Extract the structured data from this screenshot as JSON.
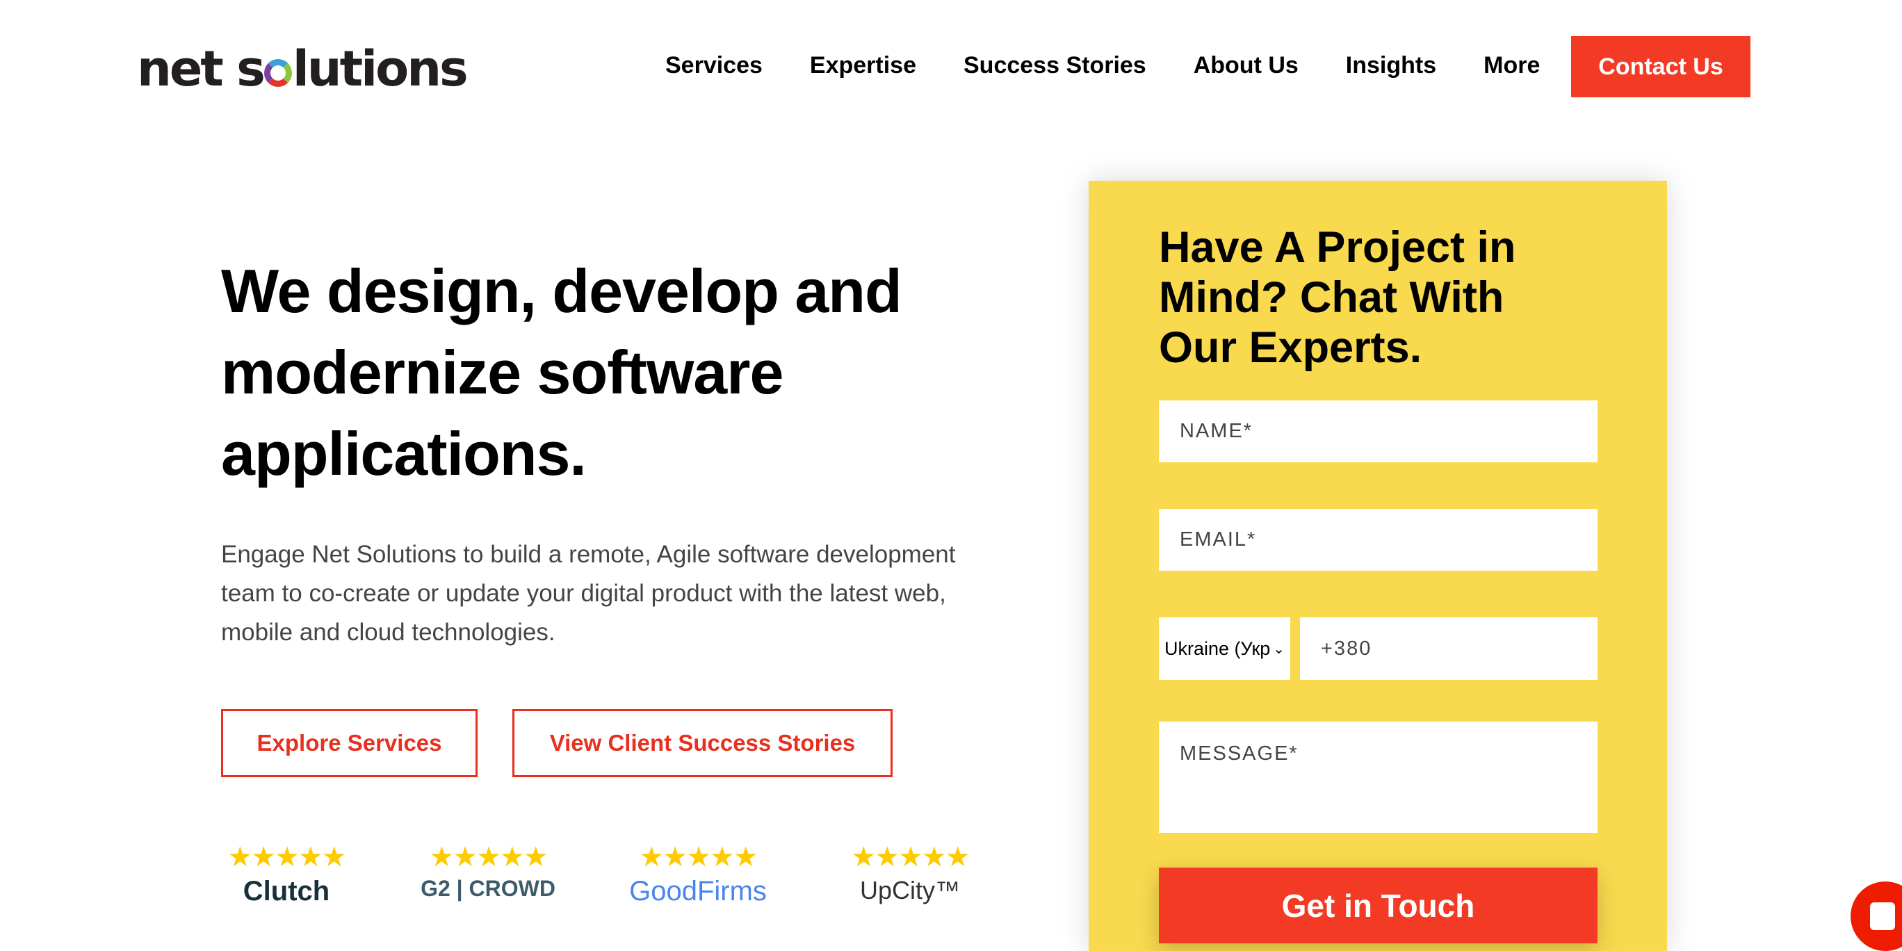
{
  "brand": {
    "logo_text_1": "net s",
    "logo_text_2": "lutions"
  },
  "nav": {
    "items": [
      "Services",
      "Expertise",
      "Success Stories",
      "About Us",
      "Insights",
      "More"
    ],
    "contact": "Contact Us"
  },
  "hero": {
    "title": "We design, develop and modernize software applications.",
    "lead": "Engage Net Solutions to build a remote, Agile software development team to co-create or update your digital product with the latest web, mobile and cloud technologies.",
    "explore": "Explore Services",
    "stories": "View Client Success Stories"
  },
  "ratings": [
    {
      "name": "Clutch",
      "stars": "★★★★★",
      "score": 4.8,
      "color": "#17313b"
    },
    {
      "name": "G2 | CROWD",
      "stars": "★★★★★",
      "score": 5,
      "color": "#3e5b6c"
    },
    {
      "name": "GoodFirms",
      "stars": "★★★★★",
      "score": 4.8,
      "color": "#4a85ee"
    },
    {
      "name": "UpCity™",
      "stars": "★★★★★",
      "score": 5,
      "color": "#333"
    }
  ],
  "form": {
    "title": "Have A Project in Mind? Chat With Our Experts.",
    "name_ph": "NAME*",
    "email_ph": "EMAIL*",
    "country": "Ukraine (Укр",
    "phone": "+380",
    "message_ph": "MESSAGE*",
    "submit": "Get in Touch"
  },
  "colors": {
    "accent": "#f33a25",
    "panel": "#f9d94e",
    "star": "#fdcb00"
  },
  "chat": {
    "icon": "chat-bubble-icon"
  }
}
